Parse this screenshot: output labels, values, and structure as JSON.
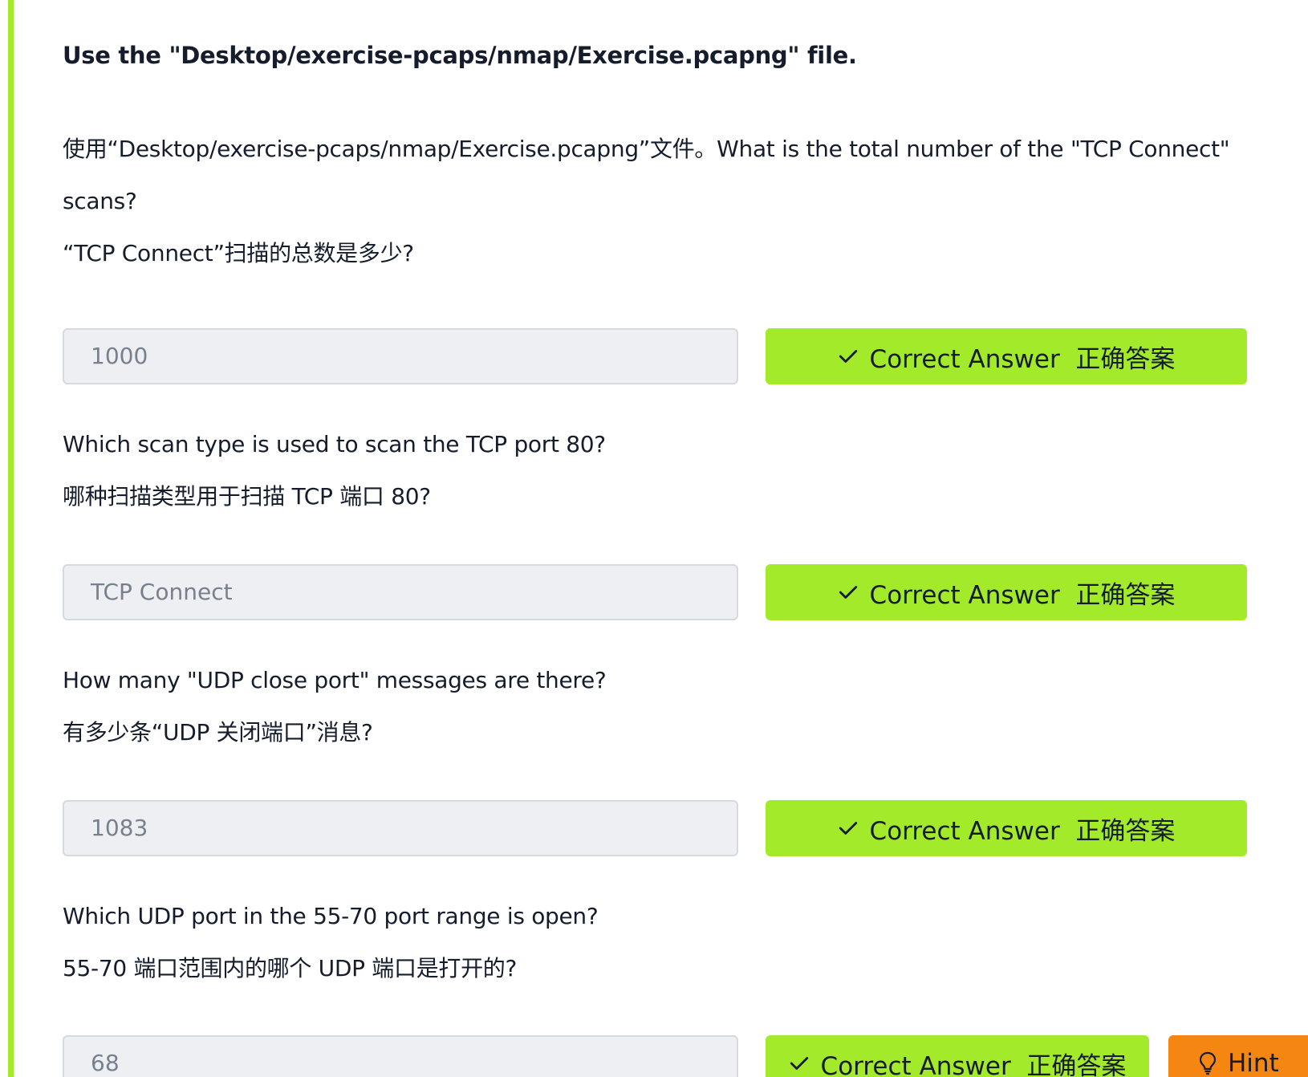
{
  "intro": "Use the \"Desktop/exercise-pcaps/nmap/Exercise.pcapng\" file.",
  "colors": {
    "accent_green": "#a3ea2a",
    "hint_orange": "#f68612",
    "field_bg": "#edeff3",
    "text": "#151c2b"
  },
  "questions": [
    {
      "lines": [
        "使用“Desktop/exercise-pcaps/nmap/Exercise.pcapng”文件。What is the total number of the \"TCP Connect\"",
        "scans?",
        "“TCP Connect”扫描的总数是多少?"
      ],
      "answer": "1000",
      "button_label": "Correct Answer  正确答案",
      "button_icon": "check-icon"
    },
    {
      "lines": [
        "Which scan type is used to scan the TCP port 80?",
        "哪种扫描类型用于扫描 TCP 端口 80?"
      ],
      "answer": "TCP Connect",
      "button_label": "Correct Answer  正确答案",
      "button_icon": "check-icon"
    },
    {
      "lines": [
        "How many \"UDP close port\" messages are there?",
        "有多少条“UDP 关闭端口”消息?"
      ],
      "answer": "1083",
      "button_label": "Correct Answer  正确答案",
      "button_icon": "check-icon"
    },
    {
      "lines": [
        "Which UDP port in the 55-70 port range is open?",
        "55-70 端口范围内的哪个 UDP 端口是打开的?"
      ],
      "answer": "68",
      "button_label": "Correct Answer  正确答案",
      "button_icon": "check-icon",
      "hint_label": "Hint",
      "hint_icon": "lightbulb-icon"
    }
  ]
}
